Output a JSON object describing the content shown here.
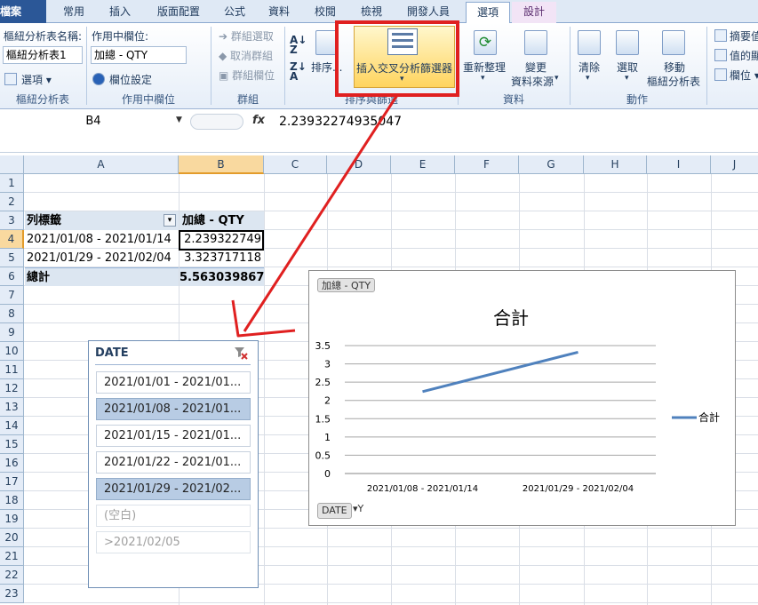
{
  "ribbon_tabs": [
    "檔案",
    "常用",
    "插入",
    "版面配置",
    "公式",
    "資料",
    "校閱",
    "檢視",
    "開發人員",
    "選項",
    "設計"
  ],
  "ribbon": {
    "pivot_name_label": "樞紐分析表名稱:",
    "pivot_name_value": "樞紐分析表1",
    "options_button": "選項",
    "group_pivot": "樞紐分析表",
    "active_field_label": "作用中欄位:",
    "active_field_value": "加總 - QTY",
    "field_settings": "欄位設定",
    "group_active_field": "作用中欄位",
    "group_selection": "群組選取",
    "ungroup": "取消群組",
    "group_field": "群組欄位",
    "group_group": "群組",
    "sort": "排序...",
    "insert_slicer": "插入交叉分析篩選器",
    "group_sort_filter": "排序與篩選",
    "refresh": "重新整理",
    "change_source_1": "變更",
    "change_source_2": "資料來源",
    "group_data": "資料",
    "clear": "清除",
    "select": "選取",
    "move_1": "移動",
    "move_2": "樞紐分析表",
    "group_actions": "動作",
    "summarize_values": "摘要值",
    "show_values": "值的顯",
    "fields_items": "欄位"
  },
  "formula_bar": {
    "name_box": "B4",
    "fx": "fx",
    "value": "2.23932274935047"
  },
  "grid": {
    "columns": [
      "A",
      "B",
      "C",
      "D",
      "E",
      "F",
      "G",
      "H",
      "I",
      "J"
    ],
    "rows": [
      "1",
      "2",
      "3",
      "4",
      "5",
      "6",
      "7",
      "8",
      "9",
      "10",
      "11",
      "12",
      "13",
      "14",
      "15",
      "16",
      "17",
      "18",
      "19",
      "20",
      "21",
      "22",
      "23"
    ],
    "row_labels_header": "列標籤",
    "sum_header": "加總 - QTY",
    "pivot_rows": [
      {
        "label": "2021/01/08 - 2021/01/14",
        "value": "2.239322749"
      },
      {
        "label": "2021/01/29 - 2021/02/04",
        "value": "3.323717118"
      }
    ],
    "total_label": "總計",
    "total_value": "5.563039867"
  },
  "slicer": {
    "title": "DATE",
    "items": [
      {
        "label": "2021/01/01 - 2021/01...",
        "state": "unselected"
      },
      {
        "label": "2021/01/08 - 2021/01...",
        "state": "selected"
      },
      {
        "label": "2021/01/15 - 2021/01...",
        "state": "unselected"
      },
      {
        "label": "2021/01/22 - 2021/01...",
        "state": "unselected"
      },
      {
        "label": "2021/01/29 - 2021/02...",
        "state": "selected"
      },
      {
        "label": "(空白)",
        "state": "nodata"
      },
      {
        "label": ">2021/02/05",
        "state": "nodata"
      }
    ]
  },
  "chart": {
    "value_field_button": "加總 - QTY",
    "axis_field_button": "DATE"
  },
  "chart_data": {
    "type": "line",
    "title": "合計",
    "categories": [
      "2021/01/08 - 2021/01/14",
      "2021/01/29 - 2021/02/04"
    ],
    "series": [
      {
        "name": "合計",
        "values": [
          2.24,
          3.32
        ],
        "color": "#4f81bd"
      }
    ],
    "yticks": [
      "0",
      "0.5",
      "1",
      "1.5",
      "2",
      "2.5",
      "3",
      "3.5"
    ],
    "ylim": [
      0,
      3.5
    ],
    "grid": true,
    "legend": "right"
  },
  "colors": {
    "accent": "#2b5797",
    "annotation": "#e02020",
    "selected_item": "#b8cce4",
    "series": "#4f81bd"
  }
}
